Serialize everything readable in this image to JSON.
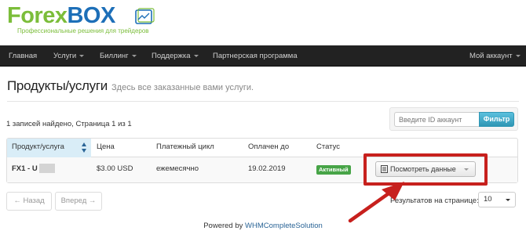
{
  "brand": {
    "name_part1": "Forex",
    "name_part2": "BOX",
    "tagline": "Профессиональные решения для трейдеров",
    "color_primary": "#7bbd3a",
    "color_secondary": "#1d6fb8"
  },
  "navbar": {
    "items": [
      {
        "label": "Главная",
        "dropdown": false
      },
      {
        "label": "Услуги",
        "dropdown": true
      },
      {
        "label": "Биллинг",
        "dropdown": true
      },
      {
        "label": "Поддержка",
        "dropdown": true
      },
      {
        "label": "Партнерская программа",
        "dropdown": false
      }
    ],
    "account_label": "Мой аккаунт"
  },
  "page": {
    "title": "Продукты/услуги",
    "subtitle": "Здесь все заказанные вами услуги."
  },
  "records_info": "1 записей найдено, Страница 1 из 1",
  "filter": {
    "placeholder": "Введите ID аккаунт",
    "button_label": "Фильтр"
  },
  "table": {
    "columns": [
      "Продукт/услуга",
      "Цена",
      "Платежный цикл",
      "Оплачен до",
      "Статус"
    ],
    "rows": [
      {
        "product": "FX1 - U",
        "price": "$3.00 USD",
        "cycle": "ежемесячно",
        "paid_until": "19.02.2019",
        "status": "Активный",
        "action_label": "Посмотреть данные"
      }
    ]
  },
  "pager": {
    "prev_label": "← Назад",
    "next_label": "Вперед →"
  },
  "results_per_page": {
    "label": "Результатов на странице:",
    "value": "10"
  },
  "footer": {
    "prefix": "Powered by",
    "link_text": "WHMCompleteSolution"
  },
  "colors": {
    "navbar_bg": "#222222",
    "highlight": "#c7201d",
    "status_active": "#47a447",
    "filter_button": "#49afcd"
  }
}
